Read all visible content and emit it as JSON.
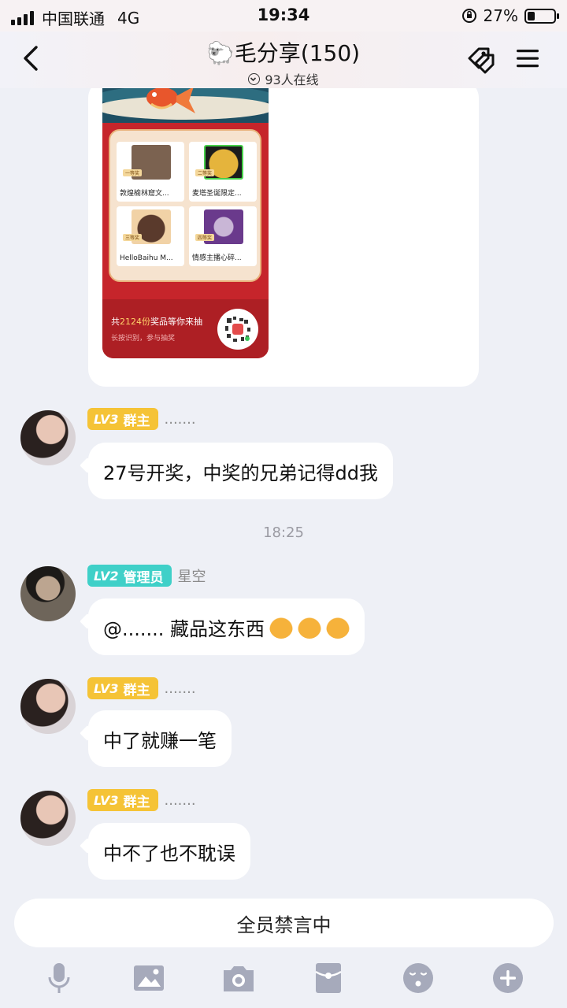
{
  "status_bar": {
    "carrier": "中国联通",
    "network": "4G",
    "time": "19:34",
    "battery_percent": "27%",
    "battery_level": 0.27
  },
  "header": {
    "title": "🐑毛分享(150)",
    "online_text": "93人在线"
  },
  "poster": {
    "prizes": [
      {
        "label": "敦煌榆林窟文...",
        "tag": "一等奖"
      },
      {
        "label": "麦塔圣诞限定...",
        "tag": "二等奖"
      },
      {
        "label": "HelloBaihu M...",
        "tag": "三等奖"
      },
      {
        "label": "情感主播心碎...",
        "tag": "四等奖"
      }
    ],
    "footer_prefix": "共",
    "footer_count": "2124份",
    "footer_suffix": "奖品等你来抽",
    "footer_sub": "长按识别，参与抽奖"
  },
  "messages": [
    {
      "badge_level": "LV3",
      "badge_role": "群主",
      "nickname": ".......",
      "text": "27号开奖，中奖的兄弟记得dd我"
    },
    {
      "badge_level": "LV2",
      "badge_role": "管理员",
      "nickname": "星空",
      "text": "@....... 藏品这东西"
    },
    {
      "badge_level": "LV3",
      "badge_role": "群主",
      "nickname": ".......",
      "text": "中了就赚一笔"
    },
    {
      "badge_level": "LV3",
      "badge_role": "群主",
      "nickname": ".......",
      "text": "中不了也不耽误"
    }
  ],
  "timestamp": "18:25",
  "mute_text": "全员禁言中",
  "toolbar_icons": [
    "microphone-icon",
    "image-icon",
    "camera-icon",
    "red-packet-icon",
    "emoji-icon",
    "plus-icon"
  ],
  "colors": {
    "owner_badge": "#f5c336",
    "admin_badge": "#3fd0c8",
    "background": "#eef0f6",
    "toolbar_icon": "#a6aabb"
  }
}
